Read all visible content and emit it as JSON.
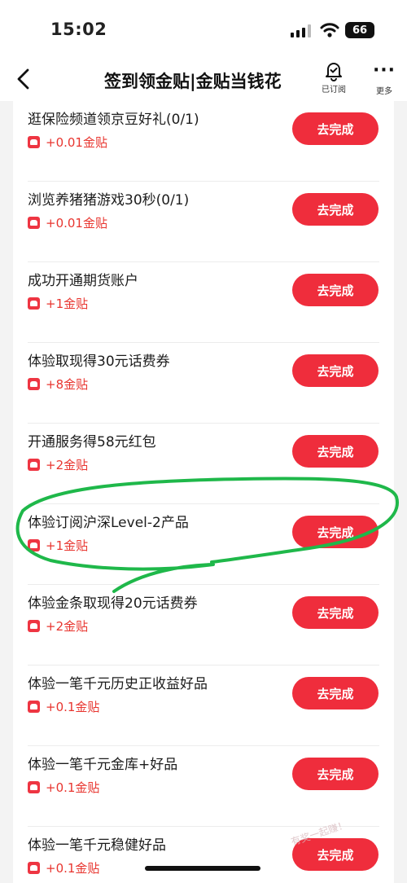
{
  "status_bar": {
    "time": "15:02",
    "battery": "66"
  },
  "nav": {
    "title": "签到领金贴|金贴当钱花",
    "subscribed_label": "已订阅",
    "more_label": "更多"
  },
  "action_label": "去完成",
  "tasks": [
    {
      "title": "逛保险频道领京豆好礼(0/1)",
      "reward": "+0.01金贴"
    },
    {
      "title": "浏览养猪猪游戏30秒(0/1)",
      "reward": "+0.01金贴"
    },
    {
      "title": "成功开通期货账户",
      "reward": "+1金贴"
    },
    {
      "title": "体验取现得30元话费券",
      "reward": "+8金贴"
    },
    {
      "title": "开通服务得58元红包",
      "reward": "+2金贴"
    },
    {
      "title": "体验订阅沪深Level-2产品",
      "reward": "+1金贴"
    },
    {
      "title": "体验金条取现得20元话费券",
      "reward": "+2金贴"
    },
    {
      "title": "体验一笔千元历史正收益好品",
      "reward": "+0.1金贴"
    },
    {
      "title": "体验一笔千元金库+好品",
      "reward": "+0.1金贴"
    },
    {
      "title": "体验一笔千元稳健好品",
      "reward": "+0.1金贴"
    }
  ],
  "watermark": "有奖一起赚！",
  "colors": {
    "accent": "#ef2d3c",
    "reward_text": "#e8352f",
    "highlight_stroke": "#1fb84a"
  }
}
